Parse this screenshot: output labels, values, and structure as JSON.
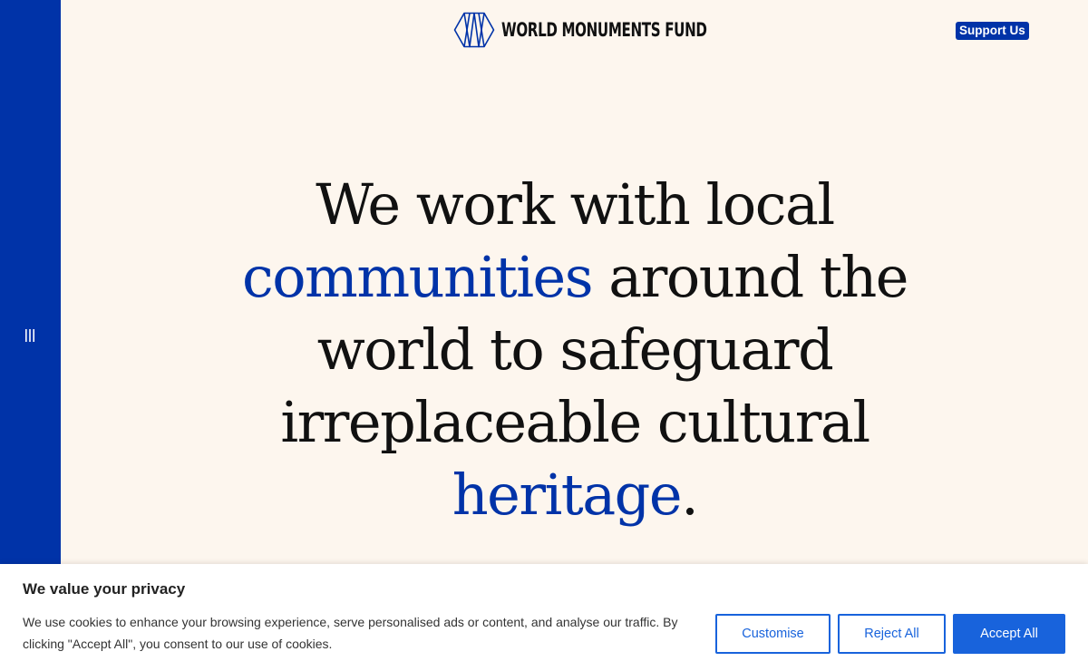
{
  "header": {
    "logo_text": "WORLD MONUMENTS FUND",
    "support_label": "Support Us"
  },
  "sidebar": {
    "menu_icon": "menu-bars-icon"
  },
  "hero": {
    "line1": "We work with local",
    "line2_accent": "communities",
    "line2_rest": " around the",
    "line3": "world to safeguard",
    "line4": "irreplaceable cultural",
    "line5_accent": "heritage",
    "line5_rest": "."
  },
  "cookie_banner": {
    "title": "We value your privacy",
    "text": "We use cookies to enhance your browsing experience, serve personalised ads or content, and analyse our traffic. By clicking \"Accept All\", you consent to our use of cookies.",
    "customise_label": "Customise",
    "reject_label": "Reject All",
    "accept_label": "Accept All"
  },
  "colors": {
    "brand_blue": "#0033a8",
    "background_cream": "#fdf6ee",
    "button_blue": "#1863dc"
  }
}
